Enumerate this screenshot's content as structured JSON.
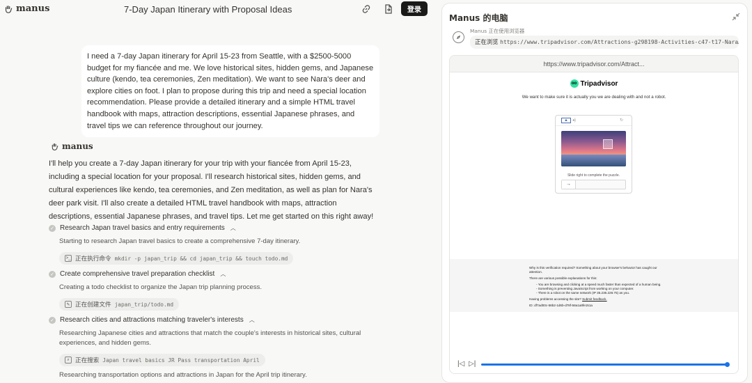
{
  "header": {
    "brand": "manus",
    "title": "7-Day Japan Itinerary with Proposal Ideas",
    "login_label": "登录"
  },
  "user_message": "I need a 7-day Japan itinerary for April 15-23 from Seattle, with a $2500-5000 budget for my fiancée and me. We love historical sites, hidden gems, and Japanese culture (kendo, tea ceremonies, Zen meditation). We want to see Nara's deer and explore cities on foot. I plan to propose during this trip and need a special location recommendation. Please provide a detailed itinerary and a simple HTML travel handbook with maps, attraction descriptions, essential Japanese phrases, and travel tips we can reference throughout our journey.",
  "agent": {
    "name": "manus",
    "message": "I'll help you create a 7-day Japan itinerary for your trip with your fiancée from April 15-23, including a special location for your proposal. I'll research historical sites, hidden gems, and cultural experiences like kendo, tea ceremonies, and Zen meditation, as well as plan for Nara's deer park visit. I'll also create a detailed HTML travel handbook with maps, attraction descriptions, essential Japanese phrases, and travel tips. Let me get started on this right away!",
    "steps": [
      {
        "title": "Research Japan travel basics and entry requirements",
        "desc": "Starting to research Japan travel basics to create a comprehensive 7-day itinerary.",
        "tool_label": "正在执行命令",
        "tool_arg": "mkdir -p japan_trip && cd japan_trip && touch todo.md"
      },
      {
        "title": "Create comprehensive travel preparation checklist",
        "desc": "Creating a todo checklist to organize the Japan trip planning process.",
        "tool_label": "正在创建文件",
        "tool_arg": "japan_trip/todo.md"
      },
      {
        "title": "Research cities and attractions matching traveler's interests",
        "desc": "Researching Japanese cities and attractions that match the couple's interests in historical sites, cultural experiences, and hidden gems.",
        "tool_label": "正在搜索",
        "tool_arg": "Japan travel basics JR Pass transportation April"
      }
    ],
    "trailing": "Researching transportation options and attractions in Japan for the April trip itinerary."
  },
  "computer": {
    "title": "Manus 的电脑",
    "status_label": "Manus 正在使用浏览器",
    "status_action": "正在浏览",
    "status_url": "https://www.tripadvisor.com/Attractions-g298198-Activities-c47-t17-Nara…",
    "browser_url": "https://www.tripadvisor.com/Attract...",
    "site_logo": "Tripadvisor",
    "robot_msg": "We want to make sure it is actually you we are dealing with and not a robot.",
    "captcha_hint": "Slide right to complete the puzzle.",
    "why_title": "Why is this verification required? Something about your browser's behavior has caught our attention.",
    "why_intro": "There are various possible explanations for this:",
    "why_items": [
      "- You are browsing and clicking at a speed much faster than expected of a human being.",
      "- Something is preventing JavaScript from working on your computer.",
      "- There is a robot on the same network (IP 35.236.228.75) as you."
    ],
    "feedback_prefix": "Having problems accessing the site?",
    "feedback_link": "Submit feedback.",
    "id_line": "ID: df7ad00c-58b2-1d6b-d78f-58a1a8fe151a",
    "progress": 1.0
  }
}
